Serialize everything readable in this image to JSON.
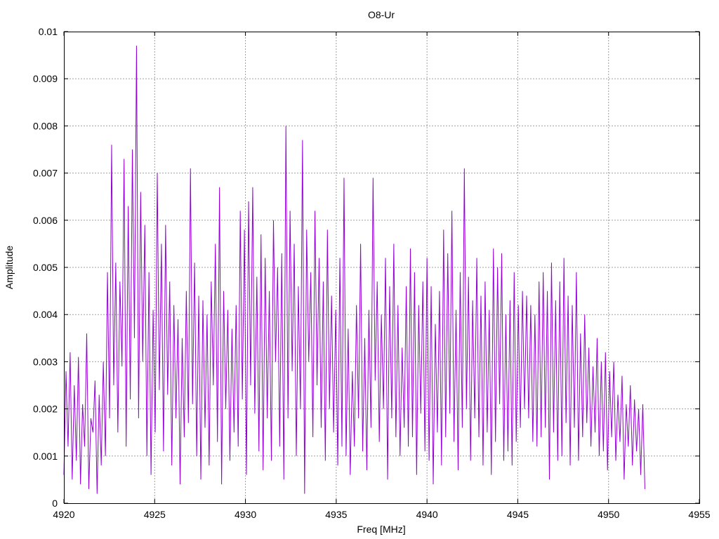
{
  "chart_data": {
    "type": "line",
    "title": "O8-Ur",
    "xlabel": "Freq [MHz]",
    "ylabel": "Amplitude",
    "xlim": [
      4920,
      4955
    ],
    "ylim": [
      0,
      0.01
    ],
    "x_ticks": [
      "4920",
      "4925",
      "4930",
      "4935",
      "4940",
      "4945",
      "4950",
      "4955"
    ],
    "y_ticks": [
      "0",
      "0.001",
      "0.002",
      "0.003",
      "0.004",
      "0.005",
      "0.006",
      "0.007",
      "0.008",
      "0.009",
      "0.01"
    ],
    "grid": true,
    "legend": "none",
    "series": [
      {
        "color": "#9400d3",
        "x_start": 4920.0,
        "x_end": 4952.0,
        "values": [
          0.0006,
          0.0028,
          0.0012,
          0.0032,
          0.0005,
          0.0025,
          0.0009,
          0.0031,
          0.0004,
          0.0021,
          0.0012,
          0.0036,
          0.0003,
          0.0018,
          0.0015,
          0.0026,
          0.0002,
          0.0023,
          0.0008,
          0.003,
          0.001,
          0.0049,
          0.0018,
          0.0076,
          0.0025,
          0.0051,
          0.0015,
          0.0047,
          0.0029,
          0.0073,
          0.0012,
          0.0063,
          0.0022,
          0.0075,
          0.0035,
          0.0097,
          0.0018,
          0.0066,
          0.003,
          0.0059,
          0.001,
          0.0049,
          0.0006,
          0.0041,
          0.0015,
          0.007,
          0.0024,
          0.0055,
          0.0011,
          0.0059,
          0.0023,
          0.0047,
          0.0008,
          0.0042,
          0.0018,
          0.0039,
          0.0004,
          0.0035,
          0.0014,
          0.0045,
          0.0017,
          0.0071,
          0.0021,
          0.0051,
          0.001,
          0.0044,
          0.0005,
          0.0043,
          0.0016,
          0.004,
          0.0008,
          0.0047,
          0.0025,
          0.0055,
          0.0013,
          0.0067,
          0.0004,
          0.0045,
          0.002,
          0.0041,
          0.0009,
          0.0037,
          0.0015,
          0.0042,
          0.0012,
          0.0062,
          0.0022,
          0.0058,
          0.0006,
          0.0064,
          0.0025,
          0.0067,
          0.0019,
          0.0048,
          0.0011,
          0.0057,
          0.0007,
          0.0052,
          0.0018,
          0.0045,
          0.0009,
          0.006,
          0.003,
          0.005,
          0.0012,
          0.0053,
          0.0005,
          0.008,
          0.0018,
          0.0062,
          0.0028,
          0.0055,
          0.001,
          0.0046,
          0.002,
          0.0077,
          0.0002,
          0.0058,
          0.003,
          0.0049,
          0.0014,
          0.0062,
          0.0025,
          0.0052,
          0.0016,
          0.0047,
          0.0009,
          0.0058,
          0.002,
          0.0044,
          0.0015,
          0.0041,
          0.0008,
          0.0052,
          0.0012,
          0.0069,
          0.001,
          0.0037,
          0.0006,
          0.0028,
          0.0012,
          0.0042,
          0.0018,
          0.0055,
          0.0011,
          0.0035,
          0.0007,
          0.0041,
          0.0016,
          0.0069,
          0.0026,
          0.0047,
          0.0013,
          0.004,
          0.002,
          0.0052,
          0.0005,
          0.0046,
          0.0018,
          0.0055,
          0.0014,
          0.0042,
          0.001,
          0.0033,
          0.0016,
          0.0046,
          0.0012,
          0.0054,
          0.0014,
          0.0049,
          0.0006,
          0.0042,
          0.0019,
          0.0047,
          0.0011,
          0.0052,
          0.0009,
          0.0046,
          0.0004,
          0.0038,
          0.0015,
          0.0045,
          0.0008,
          0.0058,
          0.0014,
          0.0053,
          0.0019,
          0.0062,
          0.0013,
          0.0041,
          0.0007,
          0.0049,
          0.0016,
          0.0071,
          0.002,
          0.0048,
          0.0009,
          0.0043,
          0.0018,
          0.0052,
          0.0014,
          0.0044,
          0.0008,
          0.0047,
          0.0015,
          0.0041,
          0.0006,
          0.0054,
          0.0013,
          0.005,
          0.0021,
          0.0053,
          0.0009,
          0.004,
          0.0011,
          0.0043,
          0.0008,
          0.0049,
          0.0013,
          0.0042,
          0.0016,
          0.0045,
          0.002,
          0.0044,
          0.0018,
          0.0042,
          0.0013,
          0.004,
          0.0012,
          0.0047,
          0.0014,
          0.0049,
          0.0016,
          0.0045,
          0.0005,
          0.0051,
          0.0015,
          0.0043,
          0.0009,
          0.0047,
          0.001,
          0.0052,
          0.0017,
          0.0044,
          0.0008,
          0.0042,
          0.0016,
          0.0049,
          0.0009,
          0.0036,
          0.0014,
          0.004,
          0.0017,
          0.0033,
          0.0012,
          0.0029,
          0.0015,
          0.0035,
          0.001,
          0.003,
          0.0011,
          0.0032,
          0.0007,
          0.0028,
          0.0014,
          0.003,
          0.0009,
          0.0023,
          0.0013,
          0.0027,
          0.0005,
          0.0021,
          0.0012,
          0.0025,
          0.0008,
          0.0022,
          0.0011,
          0.002,
          0.0006,
          0.0021,
          0.0003
        ]
      }
    ]
  }
}
